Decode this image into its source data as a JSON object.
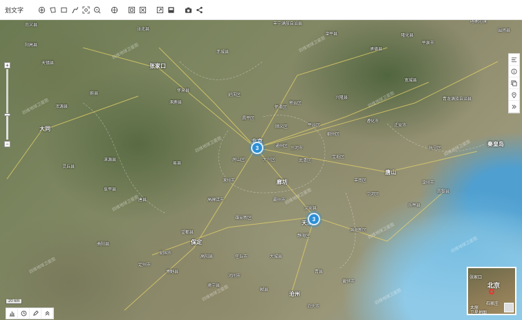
{
  "toolbar": {
    "title": "划文字",
    "icons": [
      "crosshair-icon",
      "polygon-icon",
      "rectangle-icon",
      "polyline-icon",
      "zoom-box-icon",
      "search-icon",
      "layers-icon",
      "fit-extent-icon",
      "full-extent-icon",
      "fullscreen-icon",
      "dark-mode-icon",
      "camera-icon",
      "share-icon"
    ]
  },
  "map": {
    "places": {
      "beijing": "北京",
      "tianjin": "天津",
      "langfang": "廊坊",
      "tangshan": "唐山",
      "qinhuangdao": "秦皇岛",
      "zhangjiakou": "张家口",
      "datong": "大同",
      "baoding": "保定",
      "chengde": "承德",
      "huairou": "怀柔区",
      "changping": "昌平区",
      "shunyi": "顺义区",
      "tongzhou": "通州区",
      "pinggu": "平谷区",
      "miyun": "密云区",
      "yanqing": "延庆区",
      "fangshan": "房山区",
      "daxing": "大兴区",
      "wuqing": "武清区",
      "baodi": "宝坻区",
      "jixian": "蓟州区",
      "sanhe": "三河市",
      "zhuozhou": "涿州市",
      "gaobeidian": "高碑店市",
      "bazhou": "霸州市",
      "renqiu": "任丘市",
      "cangzhou": "沧州",
      "huanghua": "黄骅市",
      "binhai": "滨海新区",
      "ninghe": "宁河区",
      "fengnan": "丰南区",
      "luanzhou": "滦州市",
      "qianan": "迁安市",
      "zunhua": "遵化市",
      "xinglong": "兴隆县",
      "kuancheng": "宽城县",
      "qinglong": "青龙满族自治县",
      "funing": "抚宁区",
      "changli": "昌黎县",
      "laoting": "乐亭县",
      "yuxian": "蔚县",
      "huailai": "怀来县",
      "zhuolu": "涿鹿县",
      "laiyuan": "涞源县",
      "yixian": "易县",
      "dingzhou": "定州市",
      "hejian": "河间市",
      "xiongan": "雄安新区",
      "gaoyang": "高阳县",
      "xianxian": "献县",
      "dacheng": "大城县",
      "wenan": "文安县",
      "jinghai": "静海区",
      "chicheng": "赤城县",
      "fengning": "丰宁满族自治县",
      "luanping": "滦平县",
      "guyuan": "沽源县",
      "zhangbei": "张北县",
      "shangyi": "尚义县",
      "yanggao": "阳高县",
      "tianzhen": "天镇县",
      "hunyuan": "浑源县",
      "lingqiu": "灵丘县",
      "fuping": "阜平县",
      "quyang": "曲阳县",
      "tangxian": "唐县",
      "wangdu": "望都县",
      "anguo": "安国市",
      "boye": "博野县",
      "suning": "肃宁县",
      "botou": "泊头市",
      "qingxian": "青县",
      "pingquan": "平泉市",
      "chengdexian": "承德县",
      "weichang": "围场县",
      "longhua": "隆化县",
      "kalaqin": "喀喇沁旗"
    },
    "watermark": "四维地球卫星图",
    "clusters": [
      {
        "count": "3"
      },
      {
        "count": "3"
      }
    ],
    "scale_label": "20 km"
  },
  "zoom": {
    "plus": "+",
    "minus": "−",
    "level_fraction": 0.35
  },
  "right_panel": {
    "icons": [
      "legend-icon",
      "info-icon",
      "copy-icon",
      "location-icon",
      "expand-icon"
    ]
  },
  "minimap": {
    "labels": {
      "beijing": "北京",
      "zhangjiakou": "张家口",
      "taiyuan": "太原",
      "shijiazhuang": "石家庄",
      "satellite": "卫星地图"
    }
  },
  "bottom_tools": {
    "icons": [
      "chart-icon",
      "history-icon",
      "edit-icon",
      "collapse-up-icon"
    ]
  }
}
